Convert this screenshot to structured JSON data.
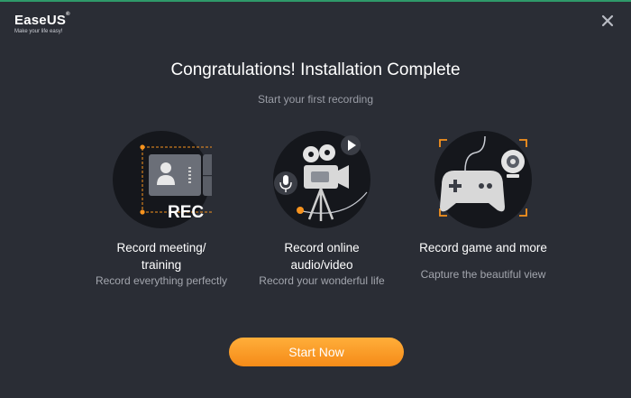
{
  "brand": {
    "name": "EaseUS",
    "trademark": "®",
    "tagline": "Make your life easy!"
  },
  "close_icon": "close-icon",
  "title": "Congratulations! Installation Complete",
  "subtitle": "Start your first recording",
  "features": [
    {
      "icon": "meeting-recording-icon",
      "badge": "REC",
      "title_line1": "Record meeting/",
      "title_line2": "training",
      "subtitle": "Record everything perfectly"
    },
    {
      "icon": "video-camera-icon",
      "title_line1": "Record online",
      "title_line2": "audio/video",
      "subtitle": "Record your wonderful life"
    },
    {
      "icon": "game-controller-icon",
      "title_line1": "Record game and more",
      "subtitle": "Capture the beautiful view"
    }
  ],
  "start_button": "Start Now",
  "colors": {
    "background": "#2a2d35",
    "accent": "#f7931e",
    "circle": "#15171c",
    "top_line": "#2f9a6a"
  }
}
